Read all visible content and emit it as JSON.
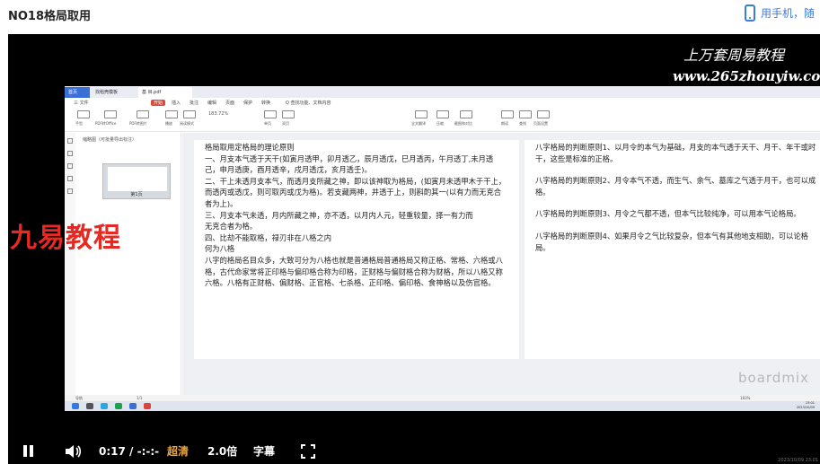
{
  "page": {
    "title": "NO18格局取用",
    "mobile_label": "用手机，随"
  },
  "video": {
    "watermark_cn": "上万套周易教程",
    "watermark_url": "www.265zhouyiw.com",
    "overlay_brand": "九易教程",
    "timestamp": "2023/10/09 23:01"
  },
  "screen": {
    "tabs": [
      "首页",
      "找稻壳模板",
      "基 目.pdf"
    ],
    "menu": [
      "三 文件",
      "开始",
      "插入",
      "批注",
      "编辑",
      "页面",
      "保护",
      "转换",
      "Q 查找功能、文档内容"
    ],
    "tool_labels": [
      "手型",
      "PDF转Office",
      "PDF转图片",
      "播放",
      "阅读模式",
      "旋转文档",
      "适合页面",
      "单页",
      "双页",
      "连续阅读",
      "自动滚动",
      "背景",
      "全文翻译",
      "压缩",
      "截图和对比",
      "朗读",
      "查找",
      "页面设置",
      "护眼",
      "截屏"
    ],
    "zoom": "183.72%",
    "pane_title": "缩略图（可批量导出标注）",
    "thumb_label": "第1页",
    "status_left": "导航",
    "status_page": "1/1",
    "status_zoom": "183%",
    "clock_time": "23:01",
    "clock_date": "2023/10/09",
    "boardmix": "boardmix",
    "page1_lines": [
      "格局取用定格局的理论原则",
      "一、月支本气透于天干(如寅月透甲，卯月透乙，辰月透戊，巳月透丙，午月透丁,未月透己，申月透庚，酉月透辛，戌月透戊，亥月透壬)。",
      "二、干上未透月支本气，而透月支所藏之神，即以该神取为格局，(如寅月未透甲木于干上，而透丙或透戊，则可取丙或戊为格)。若支藏两神，并透于上，则斟酌其一(以有力而无克合者为上)。",
      "三、月支本气未透，月内所藏之神，亦不透，以月内人元，轻重较量，择一有力而",
      "无克合者为格。",
      "四、比劫不能取格，禄刃非在八格之内",
      "何为八格",
      "八字的格局名目众多，大致可分为八格也就是普通格局普通格局又称正格、常格、六格或八格，古代命家常将正印格与偏印格合称为印格，正财格与偏财格合称为财格，所以八格又称六格。八格有正财格、偏财格、正官格、七杀格、正印格、偏印格、食神格以及伤官格。"
    ],
    "page2_lines": [
      "八字格局的判断原则1、以月令的本气为基础，月支的本气透于天干、月干、年干或时干，这些是标准的正格。",
      "八字格局的判断原则2、月令本气不透，而生气、余气、墓库之气透于月干，也可以成格。",
      "八字格局的判断原则3、月令之气都不透，但本气比较纯净，可以用本气论格局。",
      "八字格局的判断原则4、如果月令之气比较复杂，但本气有其他地支相助，可以论格局。"
    ]
  },
  "controls": {
    "current_time": "0:17",
    "separator": "/",
    "duration": "-:-:-",
    "quality": "超清",
    "speed": "2.0倍",
    "subtitle": "字幕"
  },
  "colors": {
    "accent": "#3b7ddd",
    "brand_red": "#e42a22",
    "quality": "#e8a53a"
  }
}
